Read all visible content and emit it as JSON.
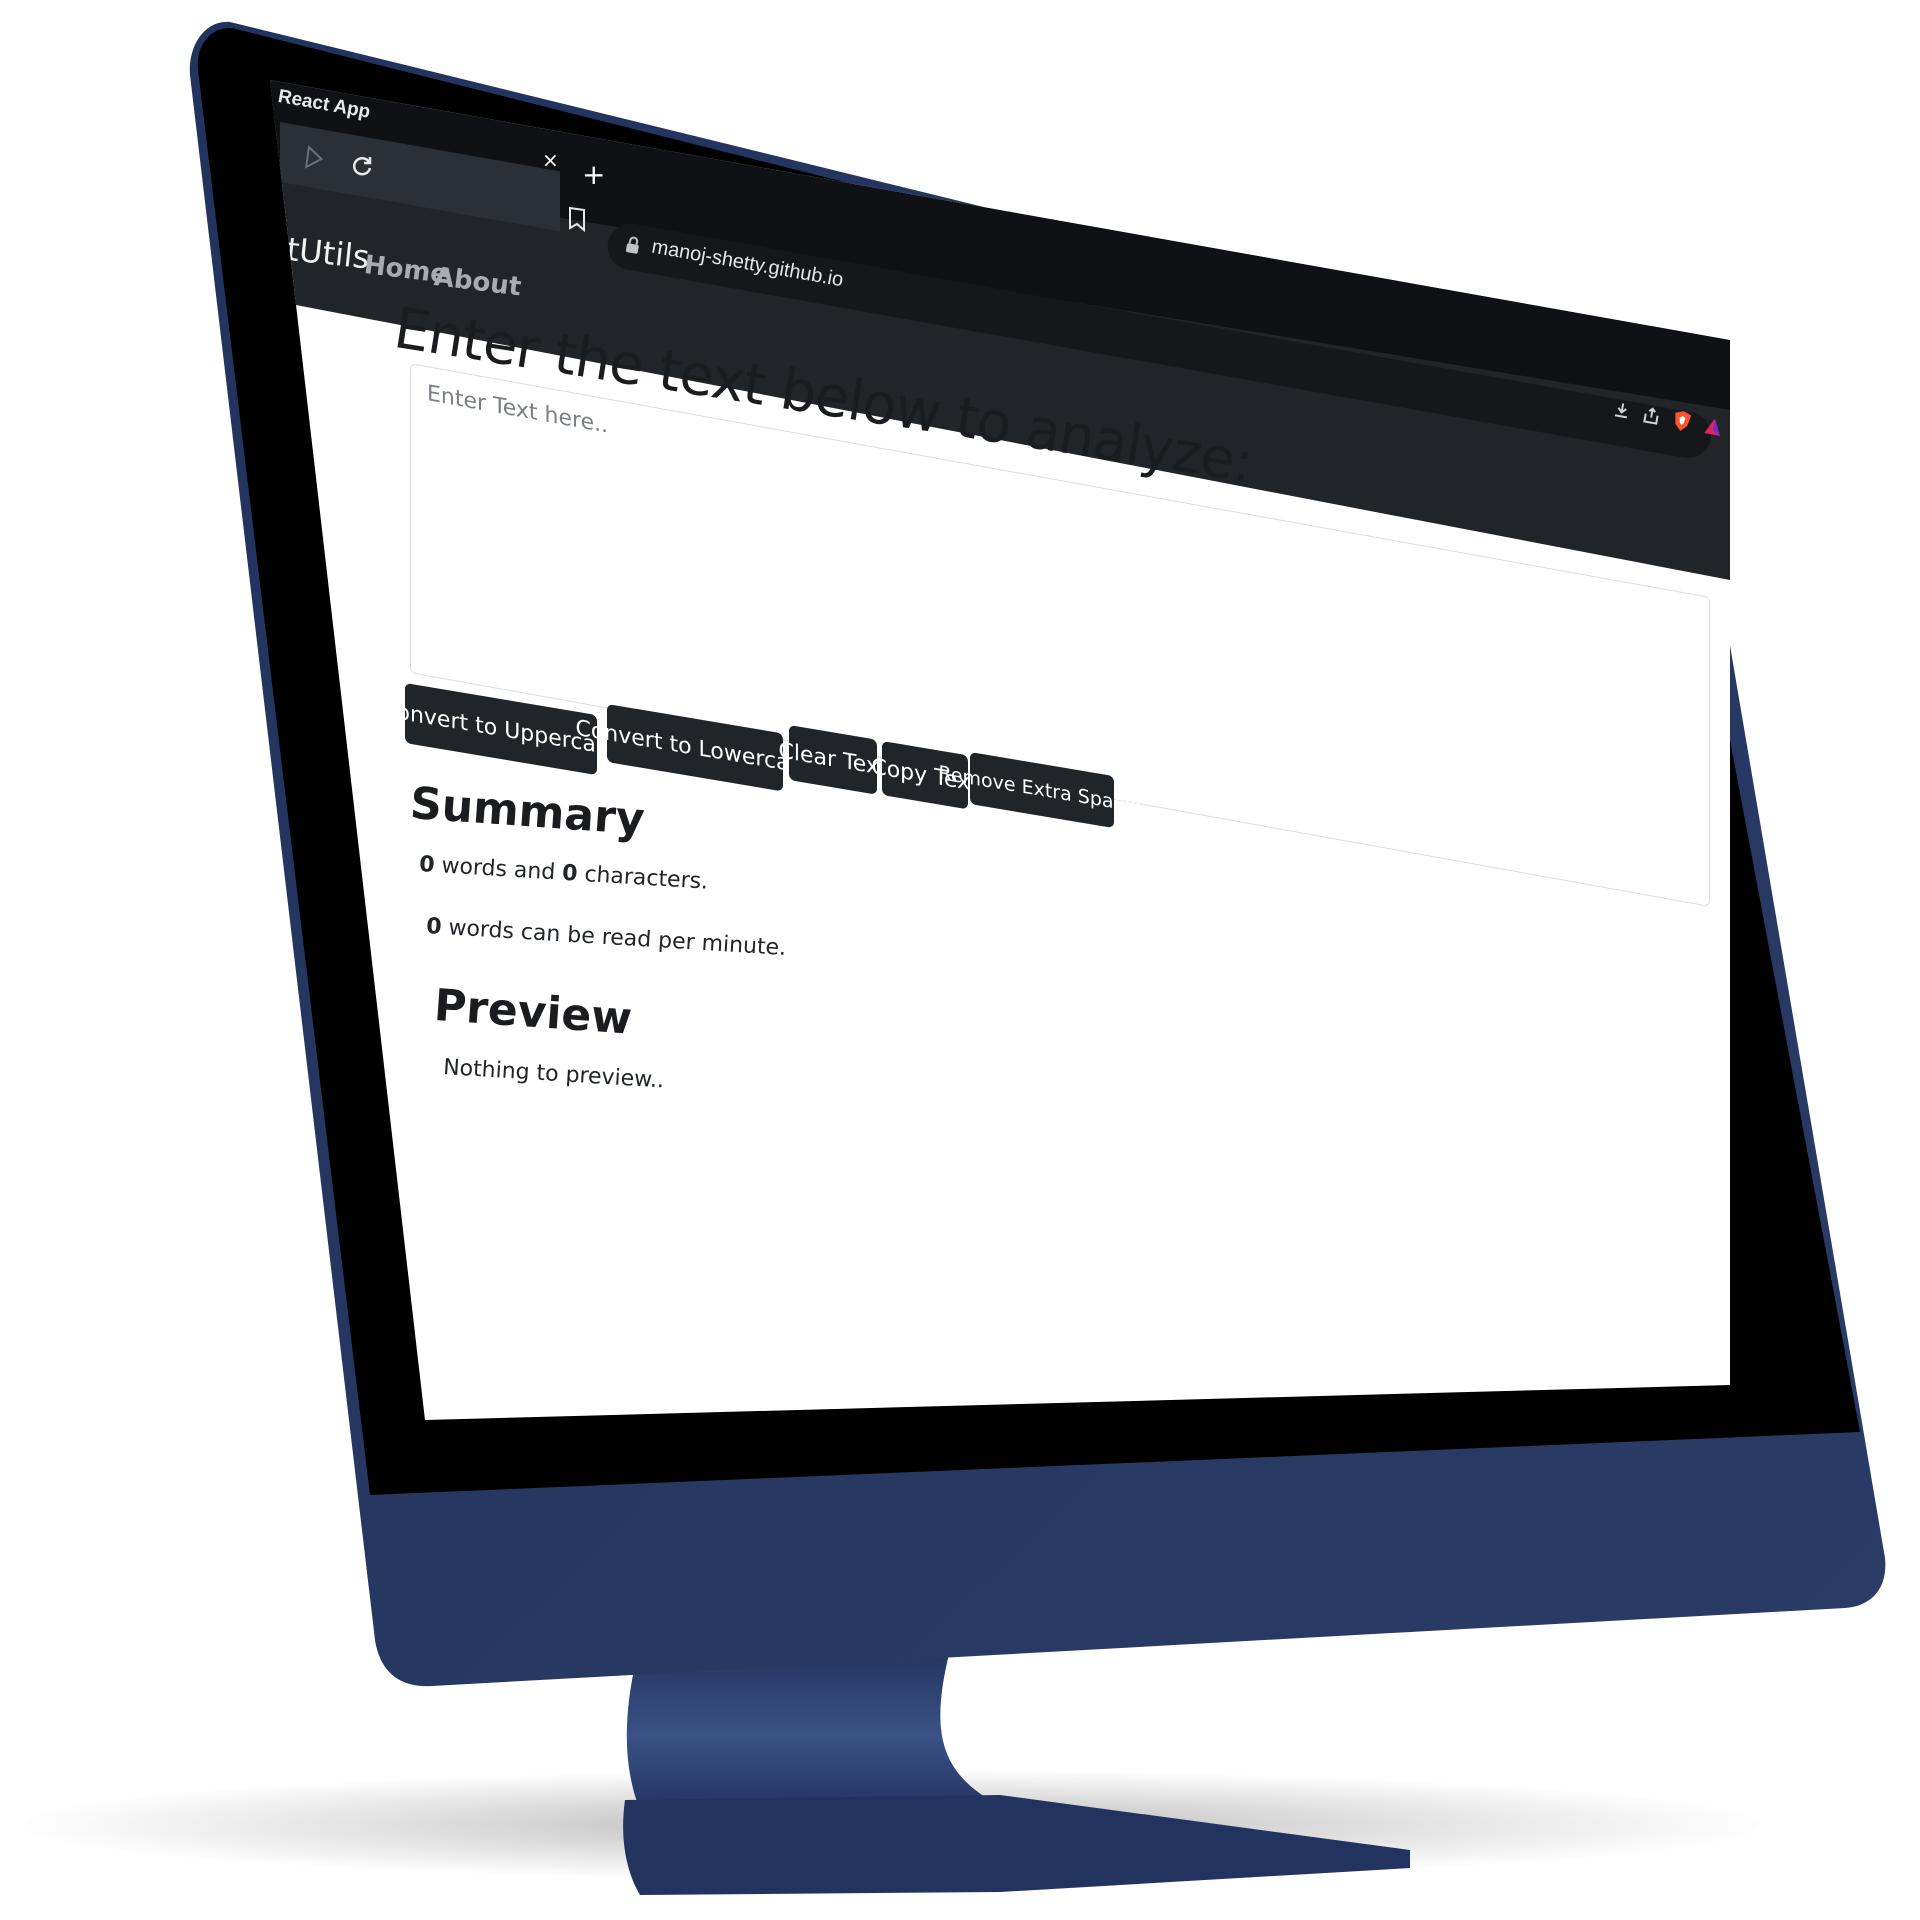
{
  "browser": {
    "window_title": "React App",
    "tab_close_glyph": "×",
    "new_tab_glyph": "+",
    "url": "manoj-shetty.github.io",
    "icons": [
      "back-icon",
      "reload-icon",
      "bookmark-icon",
      "lock-icon",
      "download-icon",
      "share-icon",
      "brave-shield-icon",
      "brave-rewards-icon"
    ]
  },
  "navbar": {
    "brand": "xtUtils",
    "links": [
      "Home",
      "About"
    ]
  },
  "form": {
    "heading": "Enter the text below to analyze:",
    "textarea_placeholder": "Enter Text here..",
    "buttons": {
      "uppercase": "Convert to Uppercase",
      "lowercase": "Convert to Lowercase",
      "clear": "Clear Text",
      "copy": "Copy Text",
      "remove_spaces": "Remove Extra Spaces"
    }
  },
  "summary": {
    "heading": "Summary",
    "word_count": "0",
    "words_and": " words and ",
    "char_count": "0",
    "characters_suffix": " characters.",
    "read_count": "0",
    "read_suffix": " words can be read per minute."
  },
  "preview": {
    "heading": "Preview",
    "empty_text": "Nothing to preview.."
  },
  "colors": {
    "monitor_frame": "#263761",
    "monitor_frame_highlight": "#3a5184",
    "bezel": "#000000",
    "chrome_bg": "#212429",
    "tabstrip_bg": "#0f1115",
    "button_bg": "#212529",
    "brave_orange": "#fb542b"
  }
}
